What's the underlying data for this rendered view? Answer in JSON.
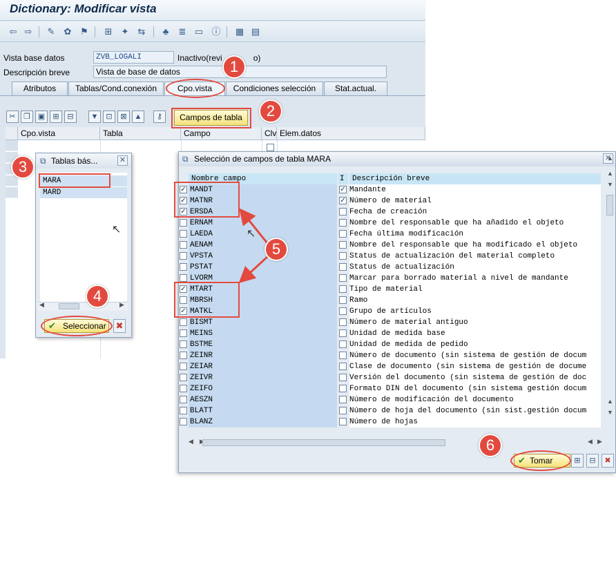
{
  "window_title": "Dictionary: Modificar vista",
  "header_fields": {
    "vista_base_label": "Vista base datos",
    "vista_base_value": "ZVB_LOGALI",
    "status_text": "Inactivo(revi",
    "status_suffix": "o)",
    "descripcion_label": "Descripción breve",
    "descripcion_value": "Vista de base de datos"
  },
  "tabs": [
    {
      "label": "Atributos"
    },
    {
      "label": "Tablas/Cond.conexión"
    },
    {
      "label": "Cpo.vista"
    },
    {
      "label": "Condiciones selección"
    },
    {
      "label": "Stat.actual."
    }
  ],
  "campos_button": "Campos de tabla",
  "grid_columns": [
    "Cpo.vista",
    "Tabla",
    "Campo",
    "Clv",
    "Elem.datos"
  ],
  "tablas_dialog": {
    "title": "Tablas bás...",
    "items": [
      "MARA",
      "MARD"
    ],
    "select_button": "Seleccionar"
  },
  "selection_dialog": {
    "title": "Selección de campos de tabla MARA",
    "col_name": "Nombre campo",
    "col_i": "I",
    "col_desc": "Descripción breve",
    "rows": [
      {
        "name": "MANDT",
        "checked": true,
        "key": true,
        "desc": "Mandante"
      },
      {
        "name": "MATNR",
        "checked": true,
        "key": true,
        "desc": "Número de material"
      },
      {
        "name": "ERSDA",
        "checked": true,
        "key": false,
        "desc": "Fecha de creación"
      },
      {
        "name": "ERNAM",
        "checked": false,
        "key": false,
        "desc": "Nombre del responsable que ha añadido el objeto"
      },
      {
        "name": "LAEDA",
        "checked": false,
        "key": false,
        "desc": "Fecha última modificación"
      },
      {
        "name": "AENAM",
        "checked": false,
        "key": false,
        "desc": "Nombre del responsable que ha modificado el objeto"
      },
      {
        "name": "VPSTA",
        "checked": false,
        "key": false,
        "desc": "Status de actualización del material completo"
      },
      {
        "name": "PSTAT",
        "checked": false,
        "key": false,
        "desc": "Status de actualización"
      },
      {
        "name": "LVORM",
        "checked": false,
        "key": false,
        "desc": "Marcar para borrado material a nivel de mandante"
      },
      {
        "name": "MTART",
        "checked": true,
        "key": false,
        "desc": "Tipo de material"
      },
      {
        "name": "MBRSH",
        "checked": false,
        "key": false,
        "desc": "Ramo"
      },
      {
        "name": "MATKL",
        "checked": true,
        "key": false,
        "desc": "Grupo de artículos"
      },
      {
        "name": "BISMT",
        "checked": false,
        "key": false,
        "desc": "Número de material antiguo"
      },
      {
        "name": "MEINS",
        "checked": false,
        "key": false,
        "desc": "Unidad de medida base"
      },
      {
        "name": "BSTME",
        "checked": false,
        "key": false,
        "desc": "Unidad de medida de pedido"
      },
      {
        "name": "ZEINR",
        "checked": false,
        "key": false,
        "desc": "Número de documento (sin sistema de gestión de docum"
      },
      {
        "name": "ZEIAR",
        "checked": false,
        "key": false,
        "desc": "Clase de documento (sin sistema de gestión de docume"
      },
      {
        "name": "ZEIVR",
        "checked": false,
        "key": false,
        "desc": "Versión del documento (sin sistema de gestión de doc"
      },
      {
        "name": "ZEIFO",
        "checked": false,
        "key": false,
        "desc": "Formato DIN del documento (sin sistema gestión docum"
      },
      {
        "name": "AESZN",
        "checked": false,
        "key": false,
        "desc": "Número de modificación del documento"
      },
      {
        "name": "BLATT",
        "checked": false,
        "key": false,
        "desc": "Número de hoja del documento (sin sist.gestión docum"
      },
      {
        "name": "BLANZ",
        "checked": false,
        "key": false,
        "desc": "Número de hojas"
      }
    ],
    "tomar_button": "Tomar"
  },
  "callouts": [
    "1",
    "2",
    "3",
    "4",
    "5",
    "6"
  ],
  "colors": {
    "accent_red": "#e34a3f",
    "button_yellow": "#f6e27a",
    "name_column_blue": "#c5daf0",
    "header_cyan": "#c7e5f5"
  }
}
